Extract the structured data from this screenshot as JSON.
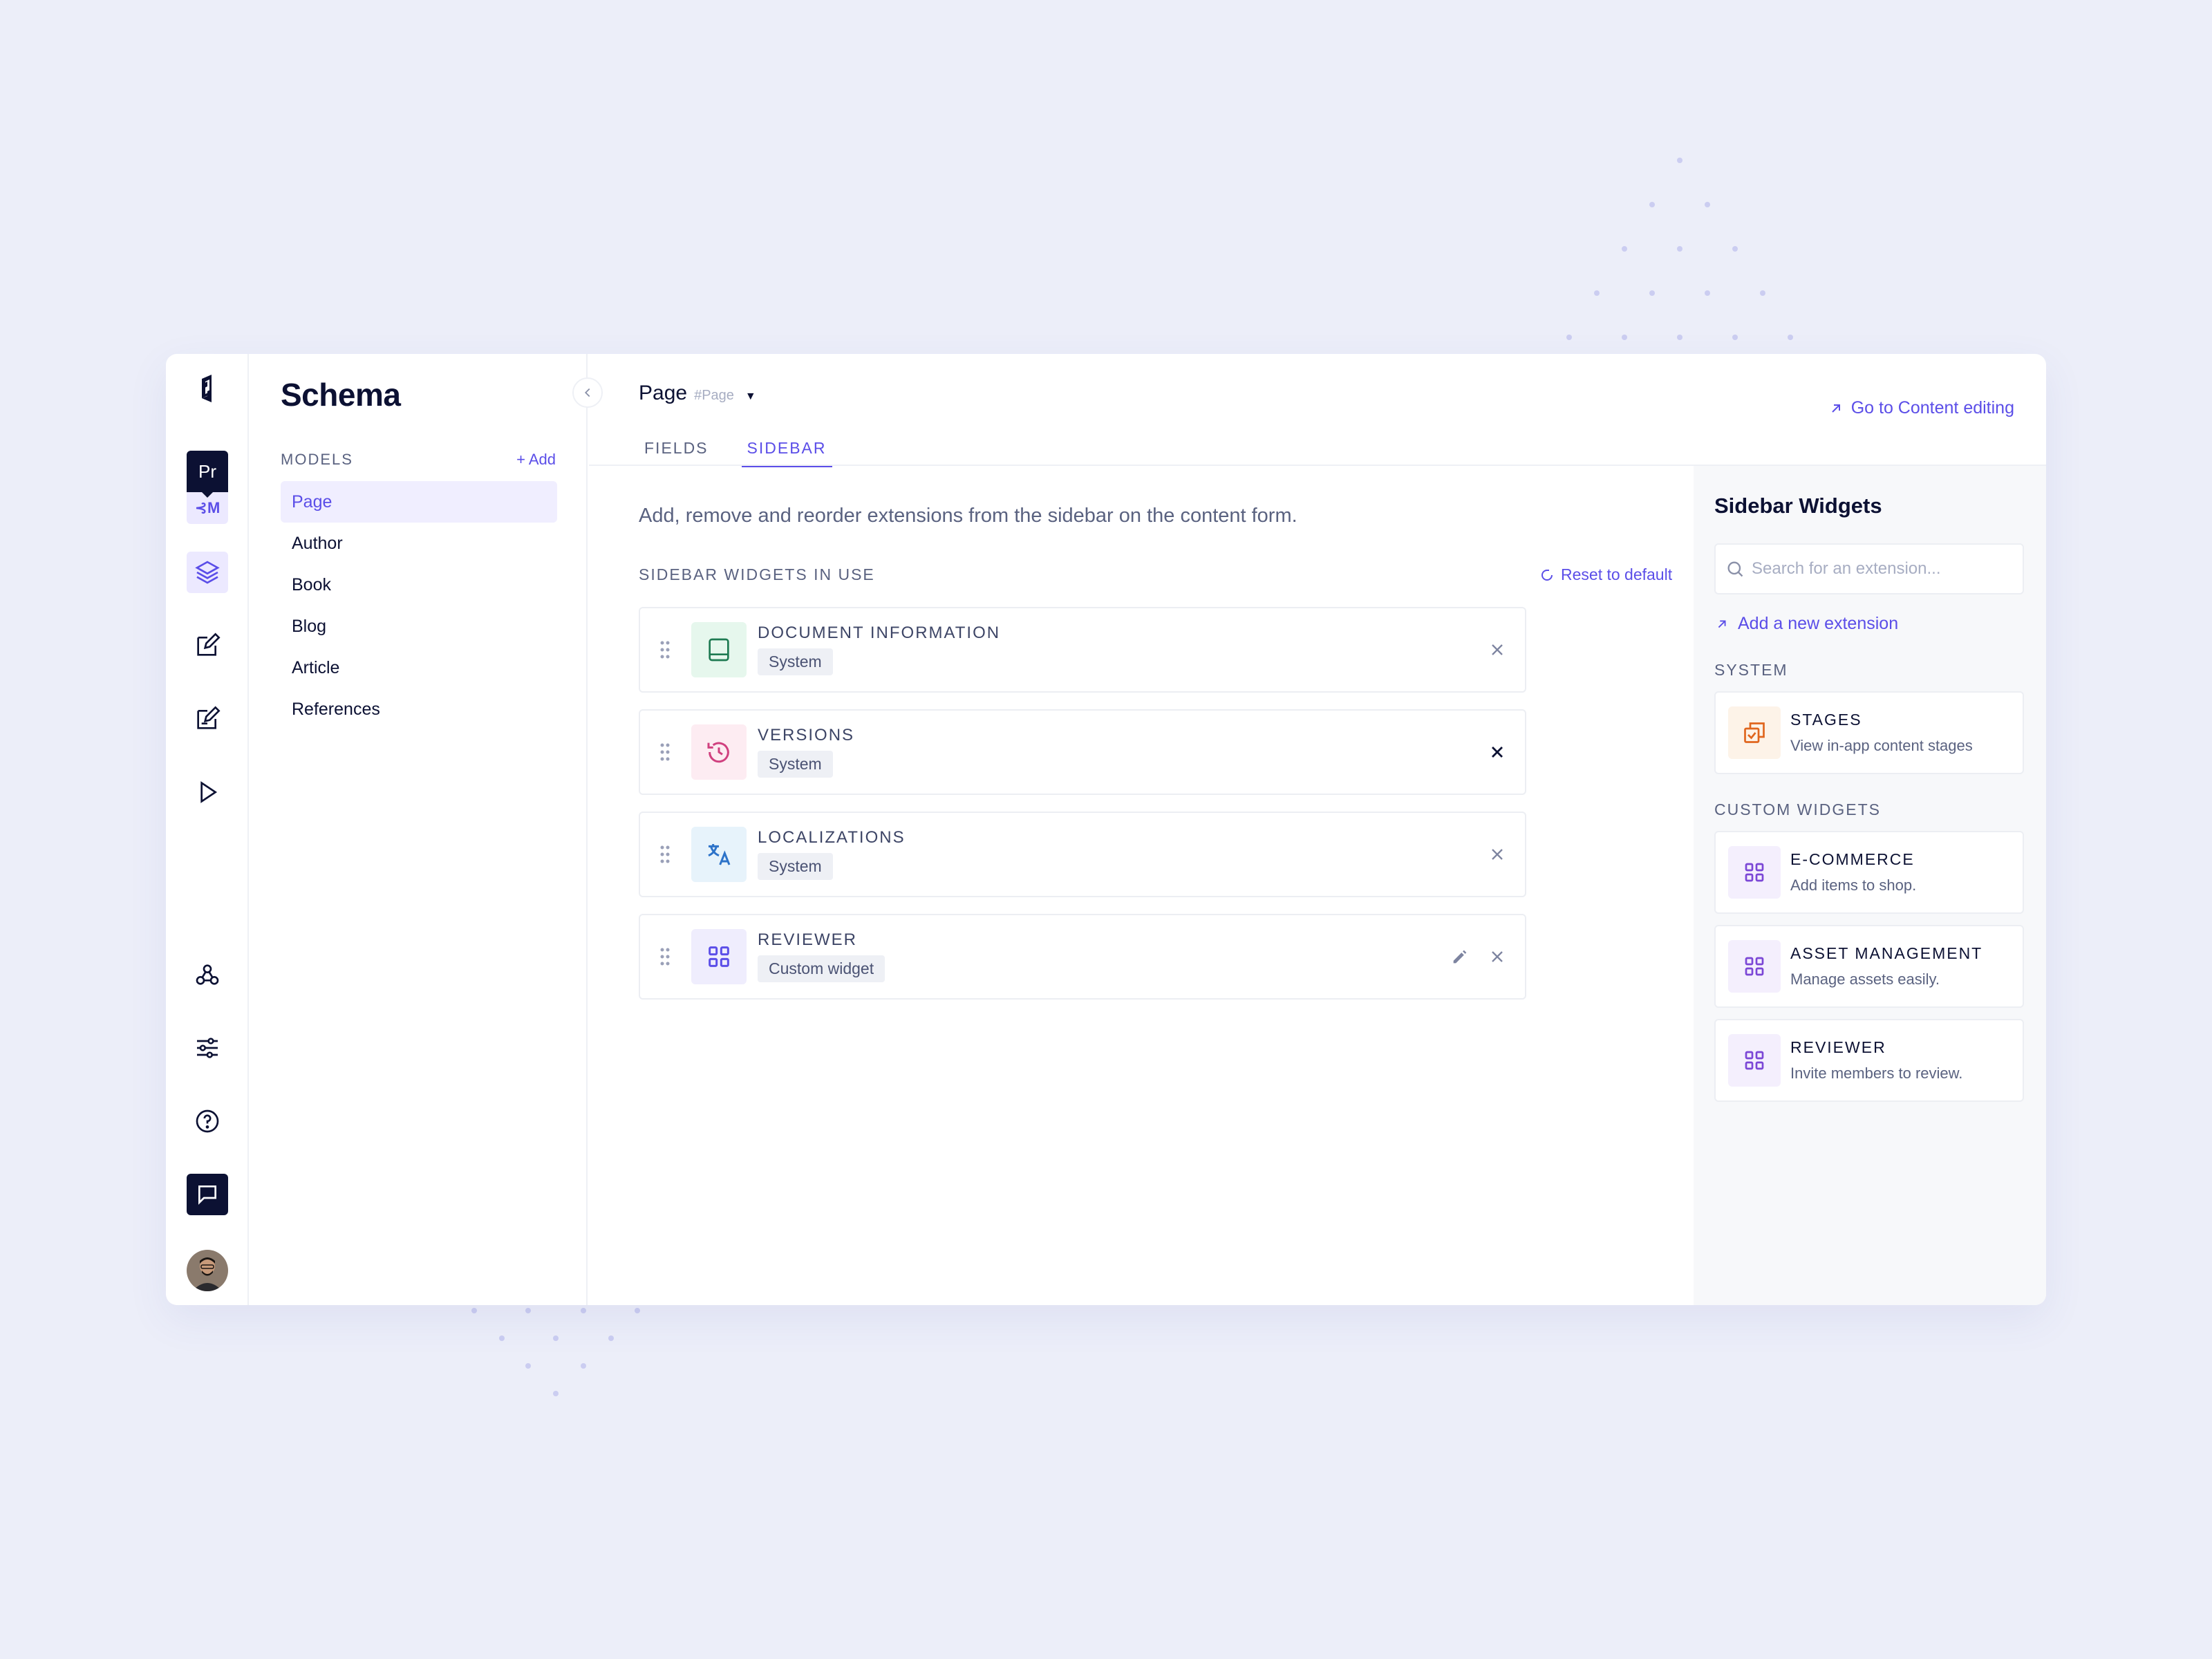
{
  "app": {
    "project_initials": "Pr",
    "project_env": "⊰M"
  },
  "models_panel": {
    "title": "Schema",
    "section_label": "MODELS",
    "add_label": "+ Add",
    "items": [
      {
        "label": "Page",
        "active": true
      },
      {
        "label": "Author",
        "active": false
      },
      {
        "label": "Book",
        "active": false
      },
      {
        "label": "Blog",
        "active": false
      },
      {
        "label": "Article",
        "active": false
      },
      {
        "label": "References",
        "active": false
      }
    ]
  },
  "header": {
    "model_name": "Page",
    "model_api_id": "#Page",
    "go_to_content": "Go to Content editing",
    "tabs": [
      {
        "label": "FIELDS",
        "active": false
      },
      {
        "label": "SIDEBAR",
        "active": true
      }
    ]
  },
  "sidebar_config": {
    "description": "Add, remove and reorder extensions from the sidebar on the content form.",
    "in_use_label": "SIDEBAR WIDGETS IN USE",
    "reset_label": "Reset to default",
    "widgets": [
      {
        "name": "DOCUMENT INFORMATION",
        "badge": "System",
        "icon": "book-icon",
        "color": "#1e7a52",
        "bg": "#e6f7ed"
      },
      {
        "name": "VERSIONS",
        "badge": "System",
        "icon": "history-icon",
        "color": "#d0407f",
        "bg": "#fdecf2"
      },
      {
        "name": "LOCALIZATIONS",
        "badge": "System",
        "icon": "translate-icon",
        "color": "#2d73c9",
        "bg": "#e7f3fb"
      },
      {
        "name": "REVIEWER",
        "badge": "Custom widget",
        "icon": "grid-icon",
        "color": "#5b4ee8",
        "bg": "#efedfd"
      }
    ]
  },
  "widgets_panel": {
    "title": "Sidebar Widgets",
    "search_placeholder": "Search for an extension...",
    "add_new": "Add a new extension",
    "system_label": "SYSTEM",
    "system_items": [
      {
        "name": "STAGES",
        "desc": "View in-app content stages",
        "icon": "stages-icon",
        "color": "#e0661e",
        "bg": "#fdf3e8"
      }
    ],
    "custom_label": "CUSTOM WIDGETS",
    "custom_items": [
      {
        "name": "E-COMMERCE",
        "desc": "Add items to shop.",
        "icon": "grid-icon",
        "color": "#7b47d6",
        "bg": "#f4effd"
      },
      {
        "name": "ASSET MANAGEMENT",
        "desc": "Manage assets easily.",
        "icon": "grid-icon",
        "color": "#7b47d6",
        "bg": "#f4effd"
      },
      {
        "name": "REVIEWER",
        "desc": "Invite members to review.",
        "icon": "grid-icon",
        "color": "#7b47d6",
        "bg": "#f4effd"
      }
    ]
  },
  "colors": {
    "accent": "#5b4ee8",
    "dark": "#0c1133",
    "background": "#eceef9"
  }
}
